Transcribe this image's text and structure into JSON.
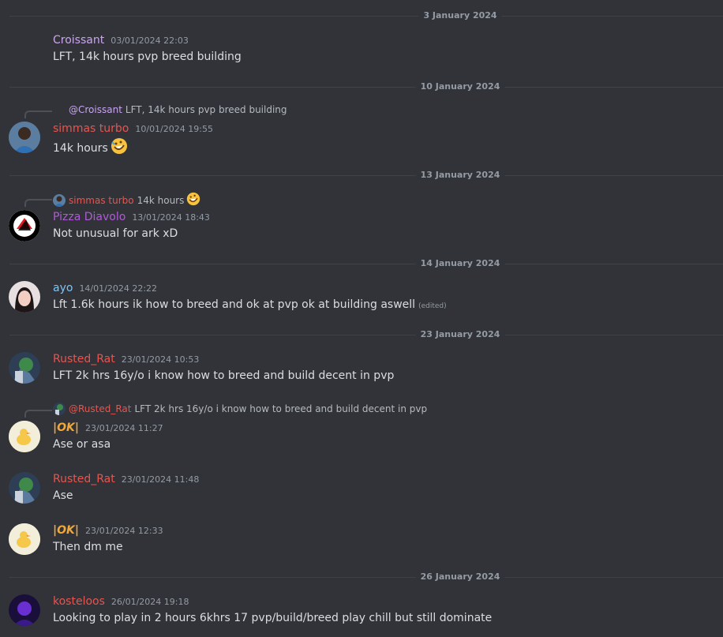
{
  "colors": {
    "background": "#313338",
    "croissant": "#c9a5f0",
    "simmas": "#e8544e",
    "pizza": "#b15ad8",
    "ayo": "#7cc5f7",
    "rusted": "#e8544e",
    "ok": "#f0a83a",
    "kosteloos": "#e8544e"
  },
  "dividers": [
    "3 January 2024",
    "10 January 2024",
    "13 January 2024",
    "14 January 2024",
    "23 January 2024",
    "26 January 2024"
  ],
  "messages": {
    "m1": {
      "author": "Croissant",
      "timestamp": "03/01/2024 22:03",
      "text": "LFT, 14k hours pvp breed building"
    },
    "m2": {
      "reply_author": "@Croissant",
      "reply_text": "LFT, 14k hours pvp breed building",
      "author": "simmas turbo",
      "timestamp": "10/01/2024 19:55",
      "text": "14k hours",
      "emoji": "rofl-emoji"
    },
    "m3": {
      "reply_author": "simmas turbo",
      "reply_text": "14k hours",
      "author": "Pizza Diavolo",
      "timestamp": "13/01/2024 18:43",
      "text": "Not unusual for ark xD"
    },
    "m4": {
      "author": "ayo",
      "timestamp": "14/01/2024 22:22",
      "text": "Lft 1.6k hours ik how to breed and ok at pvp ok at building aswell",
      "edited": "(edited)"
    },
    "m5": {
      "author": "Rusted_Rat",
      "timestamp": "23/01/2024 10:53",
      "text": "LFT 2k hrs 16y/o i know how to breed and build decent in pvp"
    },
    "m6": {
      "reply_author": "@Rusted_Rat",
      "reply_text": "LFT 2k hrs 16y/o i know how to breed and build decent in pvp",
      "author_prefix": "|",
      "author": "OK",
      "author_suffix": "|",
      "timestamp": "23/01/2024 11:27",
      "text": "Ase or asa"
    },
    "m7": {
      "author": "Rusted_Rat",
      "timestamp": "23/01/2024 11:48",
      "text": "Ase"
    },
    "m8": {
      "author_prefix": "|",
      "author": "OK",
      "author_suffix": "|",
      "timestamp": "23/01/2024 12:33",
      "text": "Then dm me"
    },
    "m9": {
      "author": "kosteloos",
      "timestamp": "26/01/2024 19:18",
      "text": "Looking to play in 2 hours 6khrs   17   pvp/build/breed play chill but still dominate"
    }
  }
}
